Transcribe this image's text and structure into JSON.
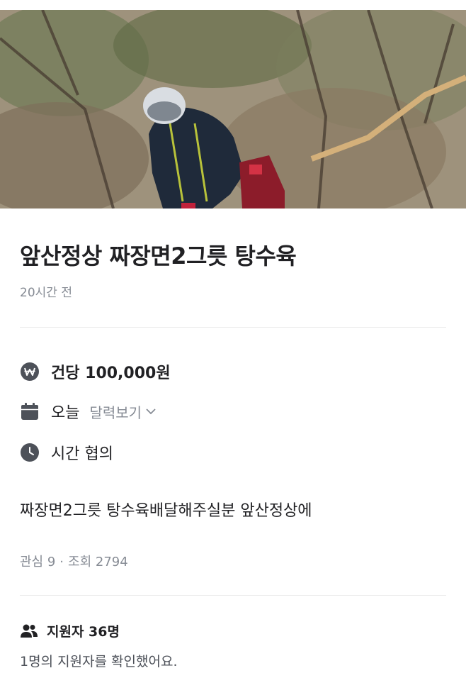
{
  "post": {
    "title": "앞산정상 짜장면2그릇 탕수육",
    "time_ago": "20시간 전",
    "price": "건당 100,000원",
    "date": "오늘",
    "calendar_link": "달력보기",
    "time": "시간 협의",
    "description": "짜장면2그릇 탕수육배달해주실분 앞산정상에",
    "stats": {
      "interest": "관심 9",
      "separator": "·",
      "views": "조회 2794"
    }
  },
  "applicants": {
    "count_label": "지원자 36명",
    "note": "1명의 지원자를 확인했어요."
  },
  "icons": {
    "price": "won-coin-icon",
    "date": "calendar-icon",
    "time": "clock-icon",
    "calendar_link": "chevron-down-icon",
    "applicants": "people-icon"
  },
  "colors": {
    "text_primary": "#212124",
    "text_secondary": "#868b94",
    "icon_gray": "#4d5159",
    "divider": "#ebebeb"
  }
}
